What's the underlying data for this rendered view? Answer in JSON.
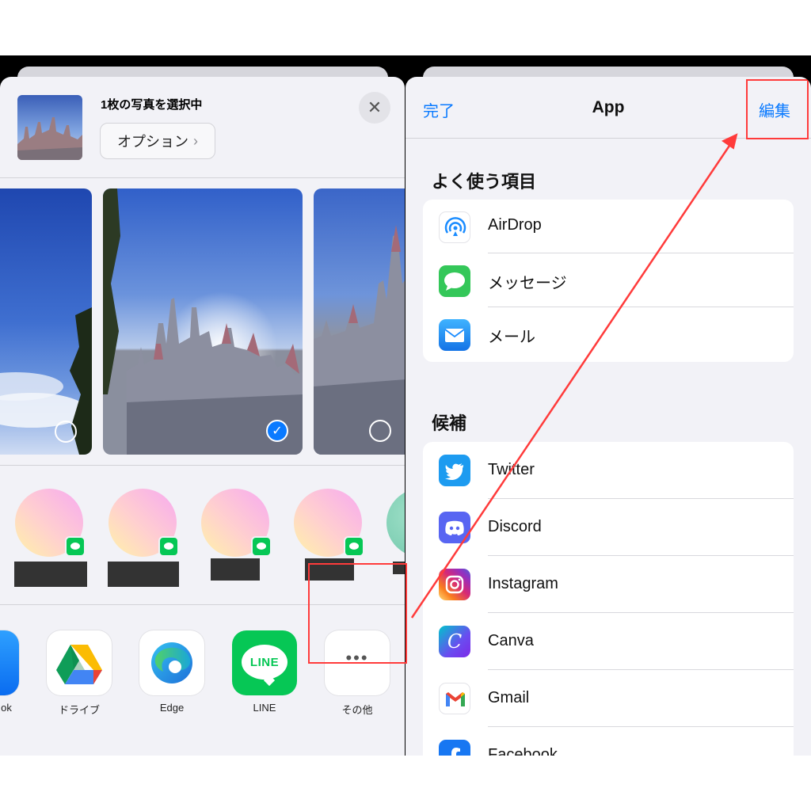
{
  "share_sheet": {
    "selection_title": "1枚の写真を選択中",
    "options_label": "オプション",
    "close_label": "✕",
    "contacts": [
      {
        "name": ""
      },
      {
        "name": ""
      },
      {
        "name": ""
      },
      {
        "name": ""
      },
      {
        "name": ""
      }
    ],
    "apps": [
      {
        "label": "ok",
        "icon": "facebook-icon"
      },
      {
        "label": "ドライブ",
        "icon": "google-drive-icon"
      },
      {
        "label": "Edge",
        "icon": "edge-icon"
      },
      {
        "label": "LINE",
        "icon": "line-icon",
        "icon_text": "LINE"
      },
      {
        "label": "その他",
        "icon": "more-icon",
        "icon_text": "•••"
      }
    ]
  },
  "app_list": {
    "done_label": "完了",
    "title": "App",
    "edit_label": "編集",
    "favorites_header": "よく使う項目",
    "favorites": [
      {
        "label": "AirDrop",
        "icon": "airdrop-icon"
      },
      {
        "label": "メッセージ",
        "icon": "messages-icon"
      },
      {
        "label": "メール",
        "icon": "mail-icon"
      }
    ],
    "suggestions_header": "候補",
    "suggestions": [
      {
        "label": "Twitter",
        "icon": "twitter-icon"
      },
      {
        "label": "Discord",
        "icon": "discord-icon"
      },
      {
        "label": "Instagram",
        "icon": "instagram-icon"
      },
      {
        "label": "Canva",
        "icon": "canva-icon",
        "icon_text": "C"
      },
      {
        "label": "Gmail",
        "icon": "gmail-icon"
      },
      {
        "label": "Facebook",
        "icon": "facebook-icon"
      }
    ]
  },
  "colors": {
    "accent": "#0a7aff",
    "highlight": "#ff3b3b",
    "sheet_bg": "#f2f2f7"
  }
}
